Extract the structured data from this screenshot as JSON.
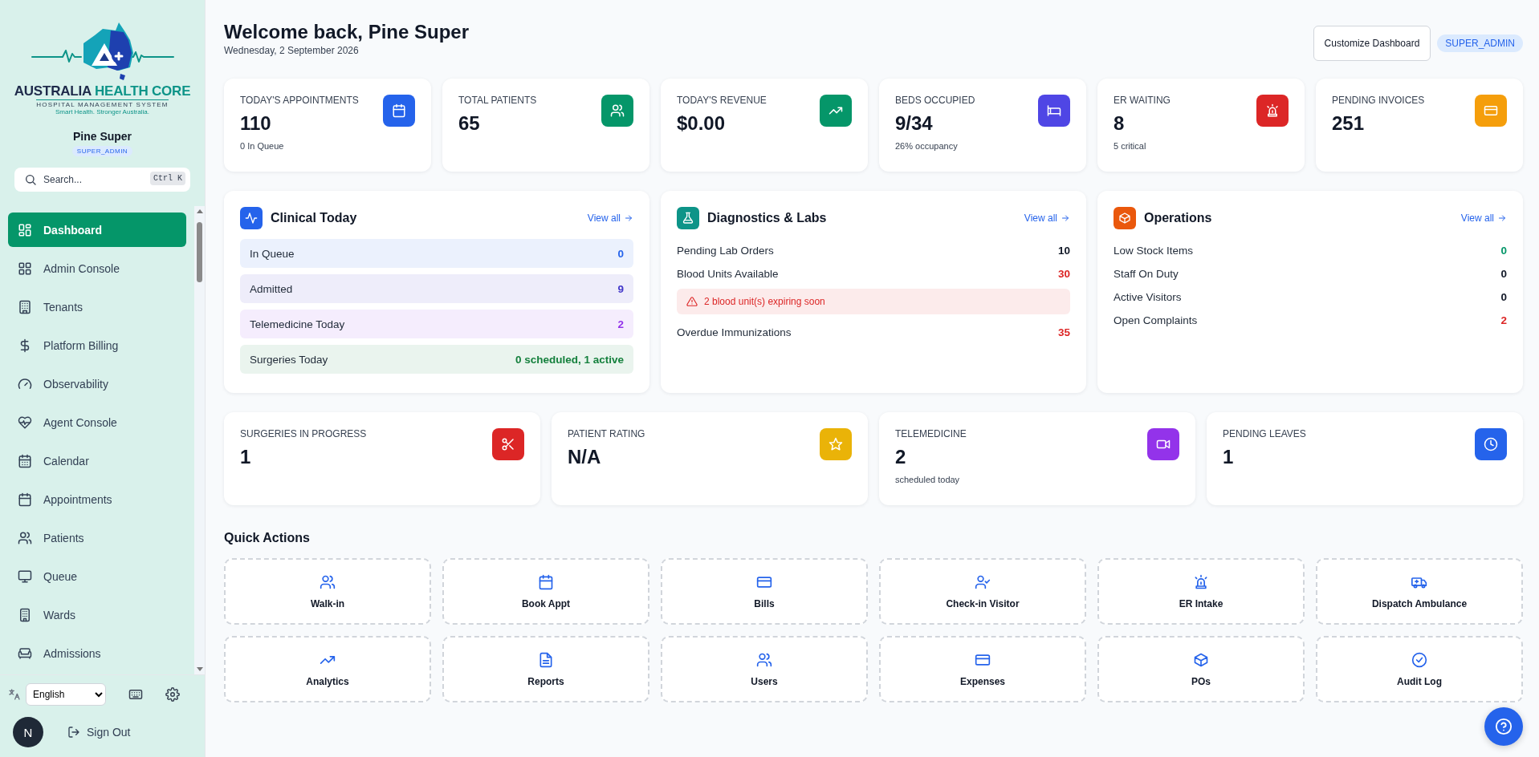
{
  "sidebar": {
    "logo": {
      "name_part1": "AUSTRALIA",
      "name_part2": "HEALTH CORE",
      "subtitle": "HOSPITAL MANAGEMENT SYSTEM",
      "tagline": "Smart Health. Stronger Australia."
    },
    "user": {
      "name": "Pine Super",
      "role": "SUPER_ADMIN"
    },
    "search": {
      "placeholder": "Search...",
      "shortcut": "Ctrl K"
    },
    "items": [
      {
        "label": "Dashboard",
        "selected": true
      },
      {
        "label": "Admin Console",
        "selected": false
      },
      {
        "label": "Tenants",
        "selected": false
      },
      {
        "label": "Platform Billing",
        "selected": false
      },
      {
        "label": "Observability",
        "selected": false
      },
      {
        "label": "Agent Console",
        "selected": false
      },
      {
        "label": "Calendar",
        "selected": false
      },
      {
        "label": "Appointments",
        "selected": false
      },
      {
        "label": "Patients",
        "selected": false
      },
      {
        "label": "Queue",
        "selected": false
      },
      {
        "label": "Wards",
        "selected": false
      },
      {
        "label": "Admissions",
        "selected": false
      }
    ],
    "language": "English",
    "avatar": "N",
    "sign_out": "Sign Out"
  },
  "header": {
    "title": "Welcome back, Pine Super",
    "date": "Wednesday, 2 September 2026",
    "button": "Customize Dashboard",
    "role": "SUPER_ADMIN"
  },
  "stats": [
    {
      "label": "TODAY'S APPOINTMENTS",
      "value": "110",
      "sub": "0 In Queue",
      "color": "#2563eb"
    },
    {
      "label": "TOTAL PATIENTS",
      "value": "65",
      "color": "#059669"
    },
    {
      "label": "TODAY'S REVENUE",
      "value": "$0.00",
      "color": "#059669"
    },
    {
      "label": "BEDS OCCUPIED",
      "value": "9/34",
      "sub": "26% occupancy",
      "color": "#4f46e5"
    },
    {
      "label": "ER WAITING",
      "value": "8",
      "sub": "5 critical",
      "color": "#dc2626"
    },
    {
      "label": "PENDING INVOICES",
      "value": "251",
      "color": "#f59e0b"
    }
  ],
  "panels": [
    {
      "title": "Clinical Today",
      "color": "#2563eb",
      "link": "View all",
      "items": [
        {
          "kind": "tile",
          "label": "In Queue",
          "value": "0",
          "color": "#2563eb"
        },
        {
          "kind": "tile",
          "label": "Admitted",
          "value": "9",
          "color": "#4338ca"
        },
        {
          "kind": "tile",
          "label": "Telemedicine Today",
          "value": "2",
          "color": "#9333ea"
        },
        {
          "kind": "tile",
          "label": "Surgeries Today",
          "value": "0 scheduled, 1 active",
          "color": "#15803d"
        }
      ]
    },
    {
      "title": "Diagnostics & Labs",
      "color": "#0d9488",
      "link": "View all",
      "items": [
        {
          "kind": "row",
          "label": "Pending Lab Orders",
          "value": "10",
          "color": "#111827"
        },
        {
          "kind": "row",
          "label": "Blood Units Available",
          "value": "30",
          "color": "#dc2626"
        },
        {
          "kind": "alert",
          "label": "2 blood unit(s) expiring soon",
          "color": "#dc2626"
        },
        {
          "kind": "row",
          "label": "Overdue Immunizations",
          "value": "35",
          "color": "#dc2626"
        }
      ]
    },
    {
      "title": "Operations",
      "color": "#ea580c",
      "link": "View all",
      "items": [
        {
          "kind": "row",
          "label": "Low Stock Items",
          "value": "0",
          "color": "#059669"
        },
        {
          "kind": "row",
          "label": "Staff On Duty",
          "value": "0",
          "color": "#111827"
        },
        {
          "kind": "row",
          "label": "Active Visitors",
          "value": "0",
          "color": "#111827"
        },
        {
          "kind": "row",
          "label": "Open Complaints",
          "value": "2",
          "color": "#dc2626"
        }
      ]
    }
  ],
  "stats2": [
    {
      "label": "SURGERIES IN PROGRESS",
      "value": "1",
      "color": "#dc2626"
    },
    {
      "label": "PATIENT RATING",
      "value": "N/A",
      "color": "#eab308"
    },
    {
      "label": "TELEMEDICINE",
      "value": "2",
      "sub": "scheduled today",
      "color": "#9333ea"
    },
    {
      "label": "PENDING LEAVES",
      "value": "1",
      "color": "#2563eb"
    }
  ],
  "quick_actions": {
    "title": "Quick Actions",
    "items": [
      "Walk-in",
      "Book Appt",
      "Bills",
      "Check-in Visitor",
      "ER Intake",
      "Dispatch Ambulance",
      "Analytics",
      "Reports",
      "Users",
      "Expenses",
      "POs",
      "Audit Log"
    ]
  }
}
